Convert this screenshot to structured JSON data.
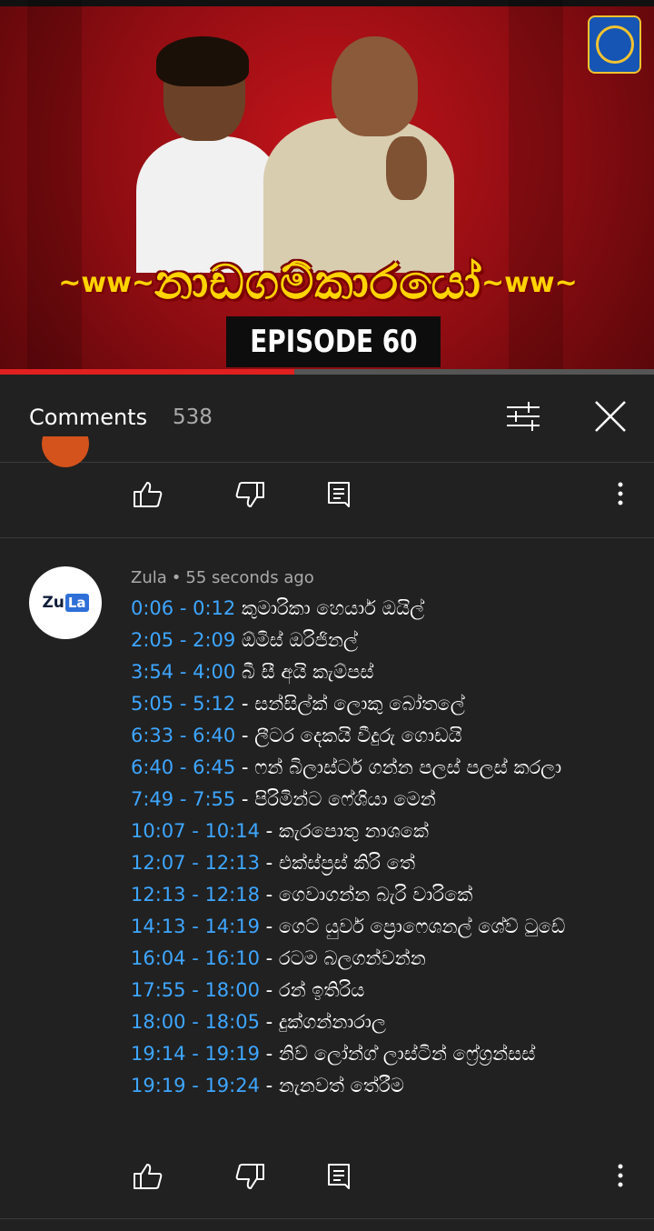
{
  "thumbnail": {
    "title": "නාඩගම්කාරයෝ",
    "episode": "EPISODE 60",
    "progress": 0.45,
    "colors": {
      "background": "#c2141a",
      "title": "#ffd400",
      "episode_bg": "#0d0d0d"
    },
    "channel_logo_icon": "channel-logo-icon"
  },
  "comments_header": {
    "title": "Comments",
    "count": "538",
    "filter_icon": "sort-filter-icon",
    "close_icon": "close-icon"
  },
  "prev_comment_actions": {
    "like_icon": "thumb-up-icon",
    "dislike_icon": "thumb-down-icon",
    "reply_icon": "reply-icon",
    "more_icon": "more-vert-icon"
  },
  "comment": {
    "avatar": {
      "part1": "Zu",
      "part2": "La"
    },
    "author": "Zula",
    "separator": "•",
    "time": "55 seconds ago",
    "timestamp_color": "#3ea6ff",
    "lines": [
      {
        "ts": "0:06 - 0:12",
        "text": " කුමාරිකා හෙයාර් ඔයිල්"
      },
      {
        "ts": "2:05 - 2:09",
        "text": " ඕමිස් ඔරිජිනල්"
      },
      {
        "ts": "3:54 - 4:00",
        "text": " බී සී අයි කැම්පස්"
      },
      {
        "ts": "5:05 - 5:12",
        "text": " - සන්සිල්ක් ලොකු බෝතලේ"
      },
      {
        "ts": "6:33 - 6:40",
        "text": " - ලීටර දෙකයි වීදුරු ගොඩයි"
      },
      {
        "ts": "6:40 - 6:45",
        "text": " - ෆන් බිලාස්ටර් ගන්න පලස් පලස් කරලා"
      },
      {
        "ts": "7:49 - 7:55",
        "text": " - පිරිමින්ට ෆේශියා මෙන්"
      },
      {
        "ts": "10:07 - 10:14",
        "text": " - කැරපොතු නාශකේ"
      },
      {
        "ts": "12:07 - 12:13",
        "text": " - එක්ස්ප්‍රස් කිරි තේ"
      },
      {
        "ts": "12:13 - 12:18",
        "text": " - ගෙවාගන්න බැරි වාරිකේ"
      },
      {
        "ts": "14:13 - 14:19",
        "text": " - ගෙට් යුවර් ප්‍රොෆෙශනල් ශේව් ටුඩේ"
      },
      {
        "ts": "16:04 - 16:10",
        "text": " - රටම බලගන්වන්න"
      },
      {
        "ts": "17:55 - 18:00",
        "text": " - රන් ඉතිරිය"
      },
      {
        "ts": "18:00 - 18:05",
        "text": " - දුක්ගන්නාරාල"
      },
      {
        "ts": "19:14 - 19:19",
        "text": " - නිව් ලෝන්ග් ලාස්ටින් ෆ්‍රේග්‍රන්සස්"
      },
      {
        "ts": "19:19 - 19:24",
        "text": " - නැනවත් තේරීම"
      }
    ]
  }
}
